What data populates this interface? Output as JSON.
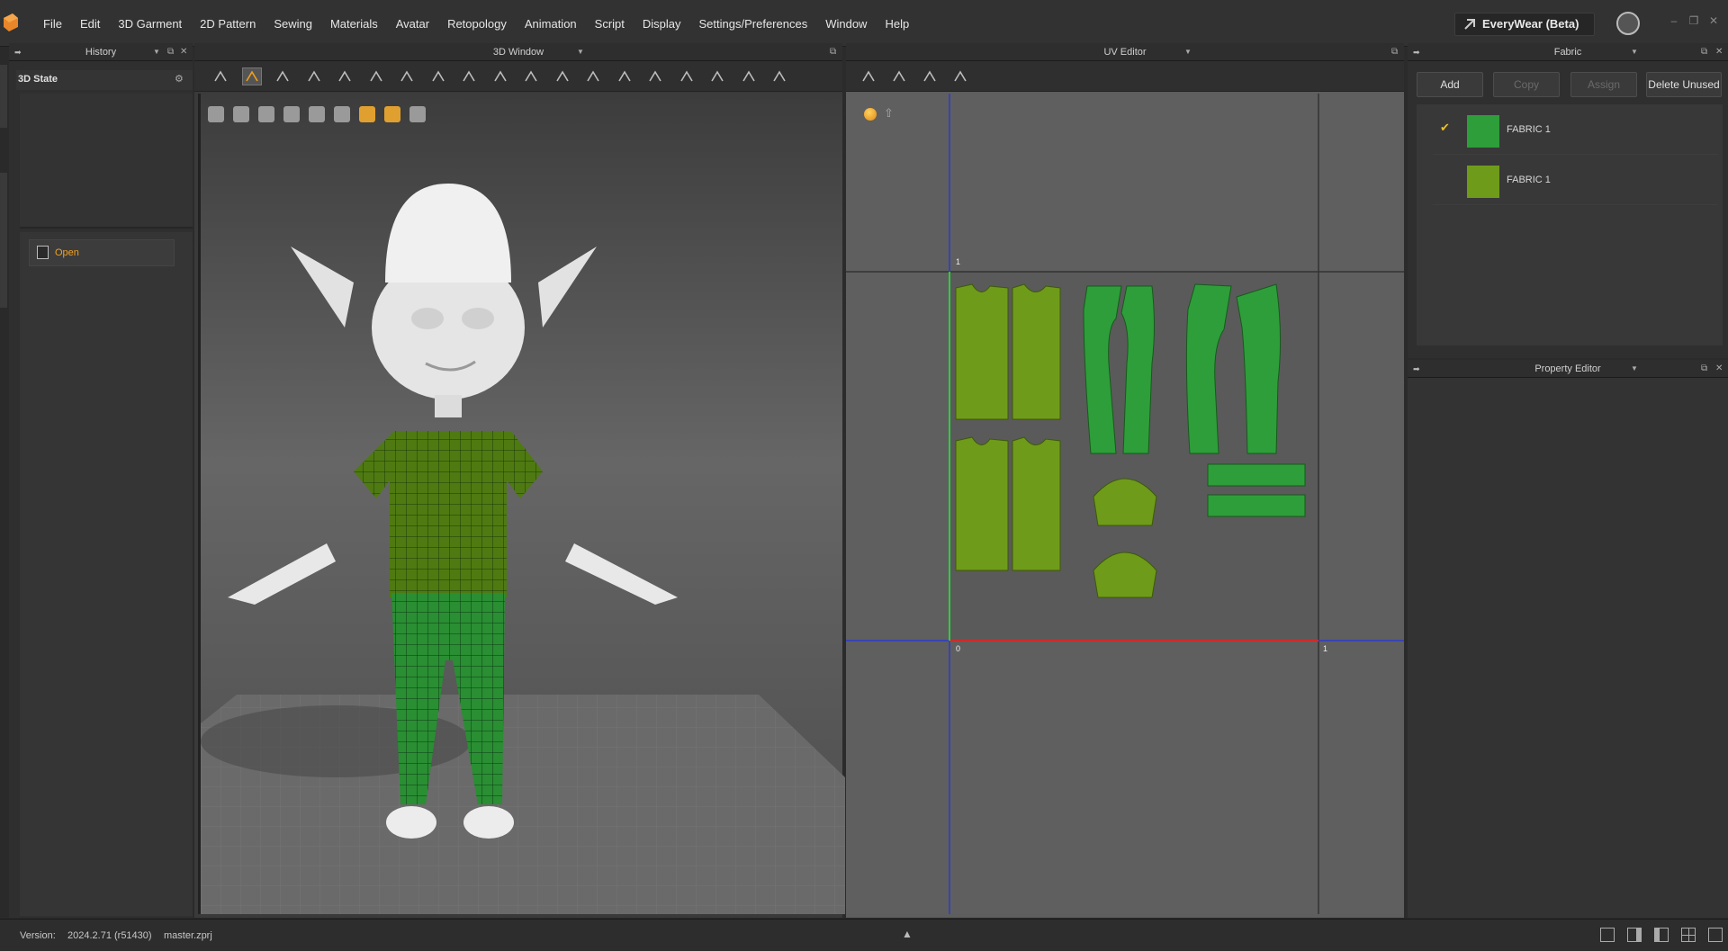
{
  "menubar": {
    "items": [
      "File",
      "Edit",
      "3D Garment",
      "2D Pattern",
      "Sewing",
      "Materials",
      "Avatar",
      "Retopology",
      "Animation",
      "Script",
      "Display",
      "Settings/Preferences",
      "Window",
      "Help"
    ],
    "workspace_label": "EveryWear (Beta)"
  },
  "history": {
    "title": "History",
    "state_label": "3D State",
    "open_label": "Open"
  },
  "window3d": {
    "title": "3D Window"
  },
  "uv": {
    "title": "UV Editor",
    "tick_top": "1",
    "tick_origin": "0",
    "tick_right": "1"
  },
  "fabric": {
    "title": "Fabric",
    "buttons": {
      "add": "Add",
      "copy": "Copy",
      "assign": "Assign",
      "delete_unused": "Delete Unused"
    },
    "items": [
      {
        "name": "FABRIC 1",
        "color": "#2e9e3a",
        "checked": true
      },
      {
        "name": "FABRIC 1",
        "color": "#6f9b1a",
        "checked": false
      }
    ]
  },
  "property_editor": {
    "title": "Property Editor"
  },
  "status": {
    "version_label": "Version:",
    "version": "2024.2.71 (r51430)",
    "file": "master.zprj"
  },
  "colors": {
    "accent": "#f0a020",
    "fabric_green": "#2e9e3a",
    "fabric_olive": "#6f9b1a"
  }
}
